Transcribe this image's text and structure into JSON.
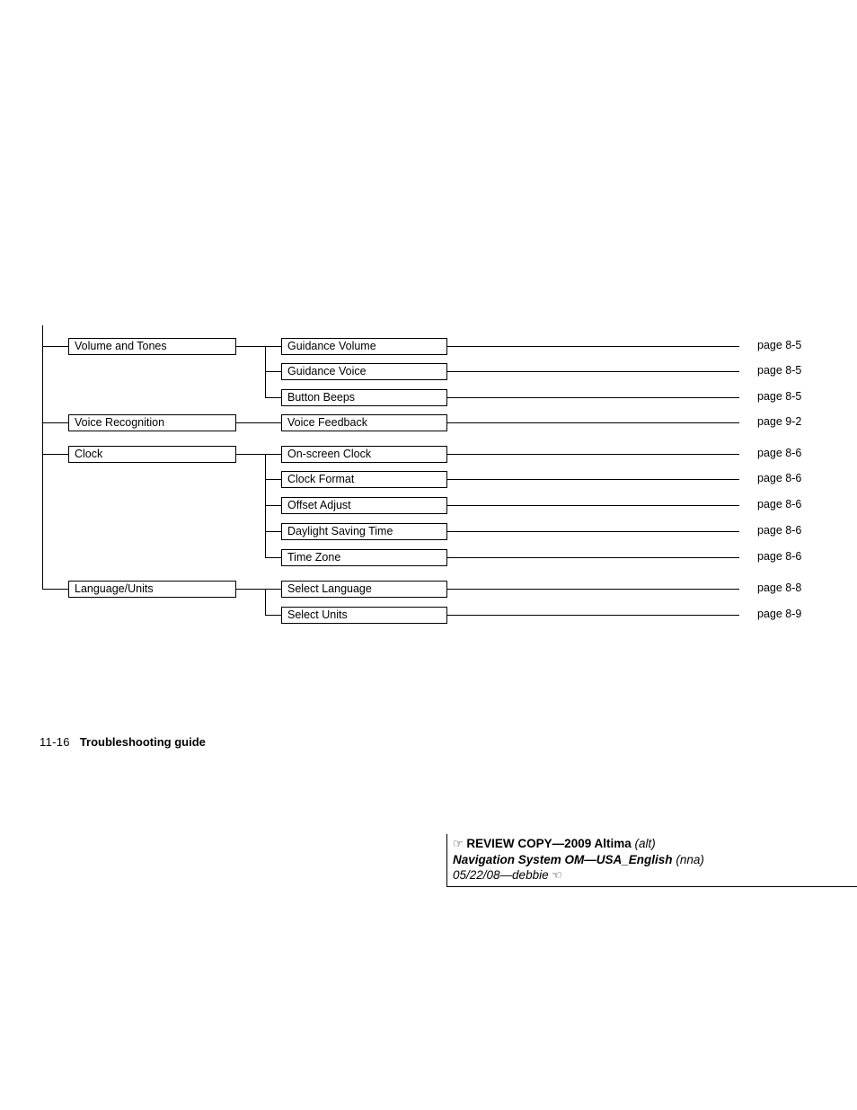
{
  "diagram": {
    "type": "tree-menu-map",
    "groups": [
      {
        "parent": "Volume and Tones",
        "children": [
          {
            "label": "Guidance Volume",
            "pageref": "page 8-5"
          },
          {
            "label": "Guidance Voice",
            "pageref": "page 8-5"
          },
          {
            "label": "Button Beeps",
            "pageref": "page 8-5"
          }
        ]
      },
      {
        "parent": "Voice Recognition",
        "children": [
          {
            "label": "Voice Feedback",
            "pageref": "page 9-2"
          }
        ]
      },
      {
        "parent": "Clock",
        "children": [
          {
            "label": "On-screen Clock",
            "pageref": "page 8-6"
          },
          {
            "label": "Clock Format",
            "pageref": "page 8-6"
          },
          {
            "label": "Offset Adjust",
            "pageref": "page 8-6"
          },
          {
            "label": "Daylight Saving Time",
            "pageref": "page 8-6"
          },
          {
            "label": "Time Zone",
            "pageref": "page 8-6"
          }
        ]
      },
      {
        "parent": "Language/Units",
        "children": [
          {
            "label": "Select Language",
            "pageref": "page 8-8"
          },
          {
            "label": "Select Units",
            "pageref": "page 8-9"
          }
        ]
      }
    ],
    "flat_parents": [
      "Volume and Tones",
      "Voice Recognition",
      "Clock",
      "Language/Units"
    ],
    "flat_children": [
      "Guidance Volume",
      "Guidance Voice",
      "Button Beeps",
      "Voice Feedback",
      "On-screen Clock",
      "Clock Format",
      "Offset Adjust",
      "Daylight Saving Time",
      "Time Zone",
      "Select Language",
      "Select Units"
    ],
    "flat_pagerefs": [
      "page 8-5",
      "page 8-5",
      "page 8-5",
      "page 9-2",
      "page 8-6",
      "page 8-6",
      "page 8-6",
      "page 8-6",
      "page 8-6",
      "page 8-8",
      "page 8-9"
    ]
  },
  "footer": {
    "folio": "11-16",
    "chapter": "Troubleshooting guide"
  },
  "review_stamp": {
    "hand_right_icon": "☞",
    "hand_left_icon": "☞",
    "line1_bold": "REVIEW COPY—2009 Altima",
    "line1_paren": "(alt)",
    "line2_bold": "Navigation System OM—USA_English",
    "line2_paren": "(nna)",
    "line3_italic": "05/22/08—debbie"
  },
  "colors": {
    "ink": "#000000",
    "paper": "#ffffff"
  }
}
